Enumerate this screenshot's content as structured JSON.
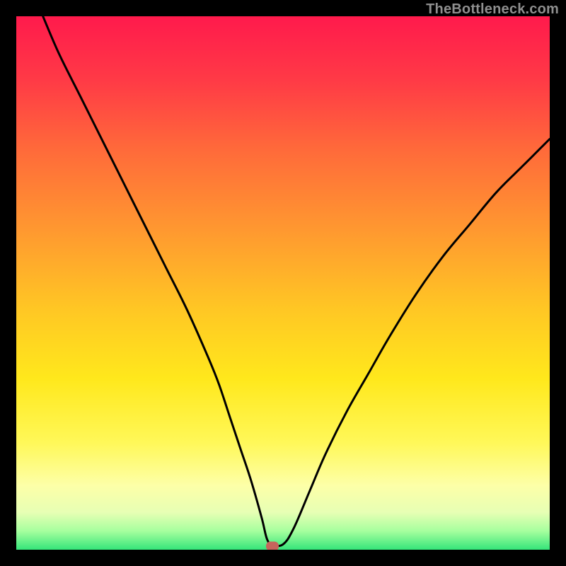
{
  "watermark": "TheBottleneck.com",
  "chart_data": {
    "type": "line",
    "title": "",
    "xlabel": "",
    "ylabel": "",
    "xlim": [
      0,
      100
    ],
    "ylim": [
      0,
      100
    ],
    "grid": false,
    "legend": false,
    "background_gradient": {
      "stops": [
        {
          "offset": 0.0,
          "color": "#ff1a4c"
        },
        {
          "offset": 0.12,
          "color": "#ff3a46"
        },
        {
          "offset": 0.25,
          "color": "#ff6a3a"
        },
        {
          "offset": 0.4,
          "color": "#ff9830"
        },
        {
          "offset": 0.55,
          "color": "#ffc724"
        },
        {
          "offset": 0.68,
          "color": "#ffe81c"
        },
        {
          "offset": 0.8,
          "color": "#fff859"
        },
        {
          "offset": 0.88,
          "color": "#fdffa8"
        },
        {
          "offset": 0.93,
          "color": "#e7ffb4"
        },
        {
          "offset": 0.965,
          "color": "#a6ff9e"
        },
        {
          "offset": 1.0,
          "color": "#35e57a"
        }
      ]
    },
    "series": [
      {
        "name": "bottleneck-curve",
        "color": "#000000",
        "x": [
          5,
          8,
          12,
          16,
          20,
          24,
          28,
          32,
          36,
          38,
          40,
          42,
          44,
          46,
          47,
          48,
          50,
          52,
          55,
          58,
          62,
          66,
          70,
          75,
          80,
          85,
          90,
          95,
          100
        ],
        "y": [
          100,
          93,
          85,
          77,
          69,
          61,
          53,
          45,
          36,
          31,
          25,
          19,
          13,
          6,
          2,
          1,
          1,
          4,
          11,
          18,
          26,
          33,
          40,
          48,
          55,
          61,
          67,
          72,
          77
        ]
      }
    ],
    "marker": {
      "name": "optimal-point",
      "x": 48,
      "y": 0.7,
      "color": "#c6645c"
    }
  }
}
